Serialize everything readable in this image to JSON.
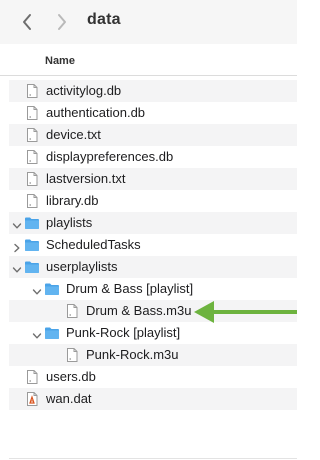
{
  "window": {
    "title": "data"
  },
  "header": {
    "name_label": "Name"
  },
  "colors": {
    "folder": "#4aa3e8",
    "arrow": "#6db33f"
  },
  "icons": {
    "back": "chevron-left-icon",
    "forward": "chevron-right-icon",
    "folder": "folder-icon",
    "file": "document-icon",
    "dat": "dat-file-icon"
  },
  "rows": [
    {
      "label": "activitylog.db",
      "icon": "file",
      "depth": 0,
      "chevron": "none"
    },
    {
      "label": "authentication.db",
      "icon": "file",
      "depth": 0,
      "chevron": "none"
    },
    {
      "label": "device.txt",
      "icon": "file",
      "depth": 0,
      "chevron": "none"
    },
    {
      "label": "displaypreferences.db",
      "icon": "file",
      "depth": 0,
      "chevron": "none"
    },
    {
      "label": "lastversion.txt",
      "icon": "file",
      "depth": 0,
      "chevron": "none"
    },
    {
      "label": "library.db",
      "icon": "file",
      "depth": 0,
      "chevron": "none"
    },
    {
      "label": "playlists",
      "icon": "folder",
      "depth": 0,
      "chevron": "open"
    },
    {
      "label": "ScheduledTasks",
      "icon": "folder",
      "depth": 0,
      "chevron": "closed"
    },
    {
      "label": "userplaylists",
      "icon": "folder",
      "depth": 0,
      "chevron": "open"
    },
    {
      "label": "Drum & Bass [playlist]",
      "icon": "folder",
      "depth": 1,
      "chevron": "open"
    },
    {
      "label": "Drum & Bass.m3u",
      "icon": "file",
      "depth": 2,
      "chevron": "none"
    },
    {
      "label": "Punk-Rock [playlist]",
      "icon": "folder",
      "depth": 1,
      "chevron": "open"
    },
    {
      "label": "Punk-Rock.m3u",
      "icon": "file",
      "depth": 2,
      "chevron": "none"
    },
    {
      "label": "users.db",
      "icon": "file",
      "depth": 0,
      "chevron": "none"
    },
    {
      "label": "wan.dat",
      "icon": "dat",
      "depth": 0,
      "chevron": "none"
    }
  ]
}
